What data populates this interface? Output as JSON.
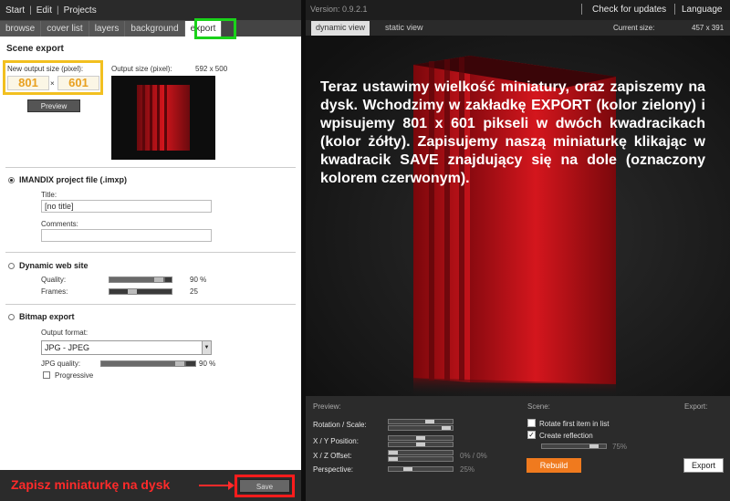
{
  "left": {
    "menubar": {
      "start": "Start",
      "edit": "Edit",
      "projects": "Projects"
    },
    "tabs": [
      {
        "label": "browse"
      },
      {
        "label": "cover list"
      },
      {
        "label": "layers"
      },
      {
        "label": "background"
      },
      {
        "label": "export",
        "active": true
      }
    ],
    "scene_export": {
      "title": "Scene export",
      "new_size_label": "New output size (pixel):",
      "width": "801",
      "times": "×",
      "height": "601",
      "output_size_label": "Output size (pixel):",
      "output_size_value": "592 x 500",
      "preview_label": "Preview"
    },
    "imandix": {
      "label": "IMANDIX project file (.imxp)",
      "title_label": "Title:",
      "title_value": "[no title]",
      "comments_label": "Comments:",
      "comments_value": ""
    },
    "dynamic_web": {
      "label": "Dynamic web site",
      "quality_label": "Quality:",
      "quality_value": "90 %",
      "quality_level": 0.9,
      "frames_label": "Frames:",
      "frames_value": "25"
    },
    "bitmap": {
      "label": "Bitmap export",
      "format_label": "Output format:",
      "format_value": "JPG - JPEG",
      "jpg_quality_label": "JPG quality:",
      "jpg_quality_value": "90 %",
      "jpg_quality_level": 0.9,
      "progressive_label": "Progressive"
    },
    "footer": {
      "save_hint": "Zapisz miniaturkę na dysk",
      "save_button": "Save"
    }
  },
  "right": {
    "version": "Version: 0.9.2.1",
    "check_updates": "Check for updates",
    "language": "Language",
    "tabs": [
      {
        "label": "dynamic view",
        "active": true
      },
      {
        "label": "static view"
      }
    ],
    "current_size_label": "Current size:",
    "current_size_value": "457 x 391",
    "caption": "Teraz ustawimy wielkość miniatury, oraz zapiszemy na dysk. Wchodzimy w zakładkę EXPORT (kolor zielony) i wpisujemy 801 x 601 pikseli w dwóch kwadracikach (kolor żółty). Zapisujemy naszą miniaturkę klikając w kwadracik SAVE znajdujący się na dole (oznaczony kolorem czerwonym).",
    "bottom": {
      "preview_title": "Preview:",
      "scene_title": "Scene:",
      "export_title": "Export:",
      "rotation_label": "Rotation / Scale:",
      "xy_label": "X / Y Position:",
      "xz_label": "X / Z Offset:",
      "xz_value": "0% / 0%",
      "perspective_label": "Perspective:",
      "perspective_value": "25%",
      "rotate_first_label": "Rotate first item in list",
      "create_reflection_label": "Create reflection",
      "reflection_value": "75%",
      "rebuild_button": "Rebuild",
      "export_button": "Export"
    }
  },
  "colors": {
    "highlight_export_tab": "#1ad21a",
    "highlight_size": "#f2c020",
    "highlight_save": "#ff1c1c",
    "rebuild_orange": "#f07a1e",
    "book_red": "#c0141a"
  }
}
